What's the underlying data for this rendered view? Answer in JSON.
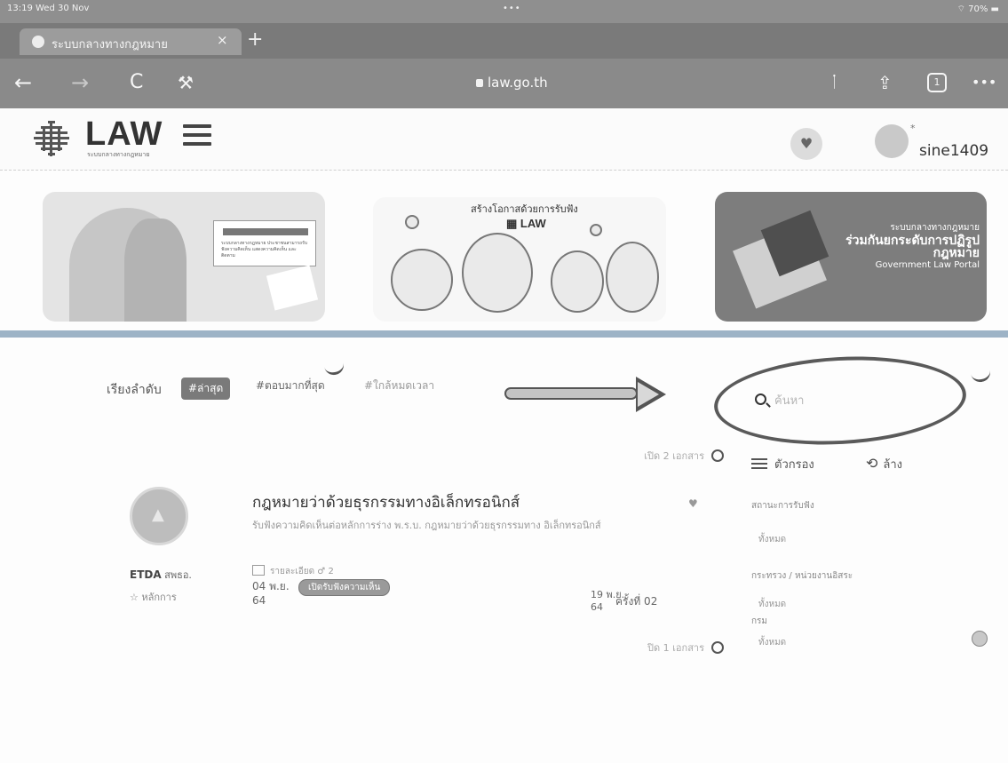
{
  "status_bar": {
    "time": "13:19  Wed 30 Nov",
    "dots": "•••",
    "right": "⌔ 70% ▬"
  },
  "browser": {
    "tab_title": "ระบบกลางทางกฎหมาย",
    "tab_close": "×",
    "new_tab": "+",
    "url": "law.go.th",
    "back": "←",
    "forward": "→",
    "reload": "C",
    "tools": "⚒",
    "mic": "ᛙ",
    "share": "⇪",
    "tab_count": "1",
    "more": "•••"
  },
  "site": {
    "logo": "LAW",
    "logo_sub": "ระบบกลางทางกฎหมาย",
    "username": "sine1409",
    "avatar_badge": "*"
  },
  "banners": [
    {
      "card_text": "ระบบกลางทางกฎหมาย ประชาชนสามารถรับฟังความคิดเห็น แสดงความคิดเห็น และติดตาม"
    },
    {
      "title": "สร้างโอกาสด้วยการรับฟัง",
      "logo": "▦ LAW"
    },
    {
      "line1": "ระบบกลางทางกฎหมาย",
      "line2": "ร่วมกันยกระดับการปฏิรูปกฎหมาย",
      "line3": "Government Law Portal"
    }
  ],
  "sort": {
    "label": "เรียงลำดับ",
    "options": [
      "#ล่าสุด",
      "#ตอบมากที่สุด",
      "#ใกล้หมดเวลา"
    ]
  },
  "search": {
    "placeholder": "ค้นหา"
  },
  "list": {
    "top_count": "เปิด 2 เอกสาร",
    "bottom_count": "ปิด 1 เอกสาร",
    "items": [
      {
        "title": "กฎหมายว่าด้วยธุรกรรมทางอิเล็กทรอนิกส์",
        "description": "รับฟังความคิดเห็นต่อหลักการร่าง พ.ร.บ. กฎหมายว่าด้วยธุรกรรมทาง อิเล็กทรอนิกส์",
        "org": "ETDA",
        "org_suffix": "สพธอ.",
        "type": "☆ หลักการ",
        "meta": "รายละเอียด   ♂ 2",
        "start_date": "04 พ.ย.",
        "start_year": "64",
        "status": "เปิดรับฟังความเห็น",
        "end_date": "19 พ.ย.",
        "end_year": "64",
        "round": "ครั้งที่  02"
      }
    ]
  },
  "filters": {
    "toggle_label": "ตัวกรอง",
    "clear_label": "ล้าง",
    "groups": [
      {
        "label": "สถานะการรับฟัง",
        "value": "ทั้งหมด"
      },
      {
        "label": "กระทรวง / หน่วยงานอิสระ",
        "value": "ทั้งหมด"
      },
      {
        "label": "กรม",
        "value": "ทั้งหมด"
      }
    ]
  }
}
